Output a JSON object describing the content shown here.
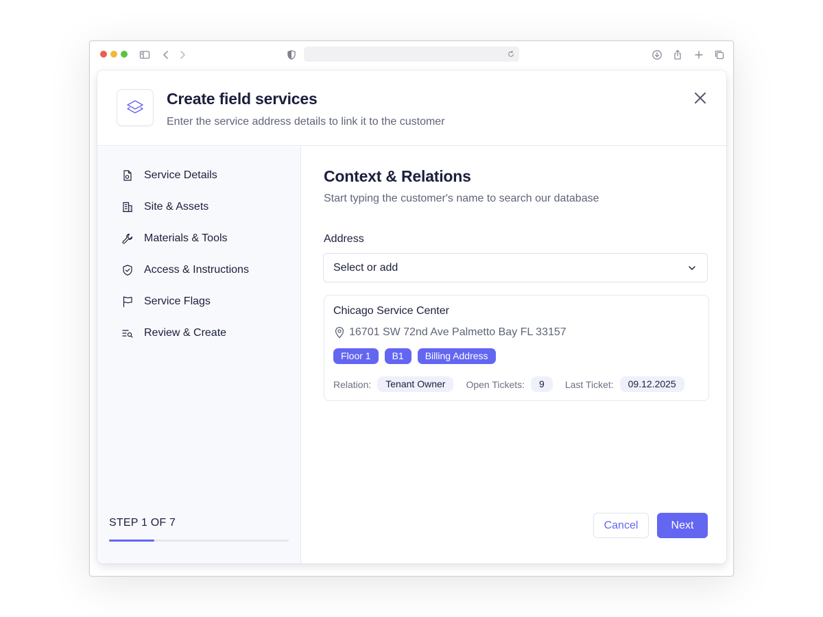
{
  "colors": {
    "accent": "#6366f1",
    "text": "#1b1f3b",
    "muted": "#5f6478"
  },
  "browser": {
    "icons": [
      "sidebar-icon",
      "back-icon",
      "forward-icon",
      "shield-icon",
      "reload-icon",
      "download-icon",
      "share-icon",
      "new-tab-icon",
      "tabs-icon"
    ]
  },
  "modal": {
    "title": "Create field services",
    "subtitle": "Enter the service address details to link it to the customer"
  },
  "sidebar": {
    "items": [
      {
        "label": "Service Details",
        "icon": "file-icon"
      },
      {
        "label": "Site & Assets",
        "icon": "building-icon"
      },
      {
        "label": "Materials & Tools",
        "icon": "wrench-icon"
      },
      {
        "label": "Access & Instructions",
        "icon": "shield-check-icon"
      },
      {
        "label": "Service Flags",
        "icon": "flag-icon"
      },
      {
        "label": "Review & Create",
        "icon": "list-search-icon"
      }
    ],
    "step_label": "STEP 1 OF 7",
    "progress": 0.25
  },
  "content": {
    "title": "Context & Relations",
    "subtitle": "Start typing the customer's name to search our database",
    "address_label": "Address",
    "address_select_value": "Select or add",
    "card": {
      "name": "Chicago Service Center",
      "address": "16701 SW 72nd Ave Palmetto Bay FL 33157",
      "tags": [
        "Floor 1",
        "B1",
        "Billing Address"
      ],
      "relation_label": "Relation:",
      "relation_value": "Tenant Owner",
      "open_tickets_label": "Open Tickets:",
      "open_tickets_value": "9",
      "last_ticket_label": "Last Ticket:",
      "last_ticket_value": "09.12.2025"
    }
  },
  "footer": {
    "cancel_label": "Cancel",
    "next_label": "Next"
  }
}
